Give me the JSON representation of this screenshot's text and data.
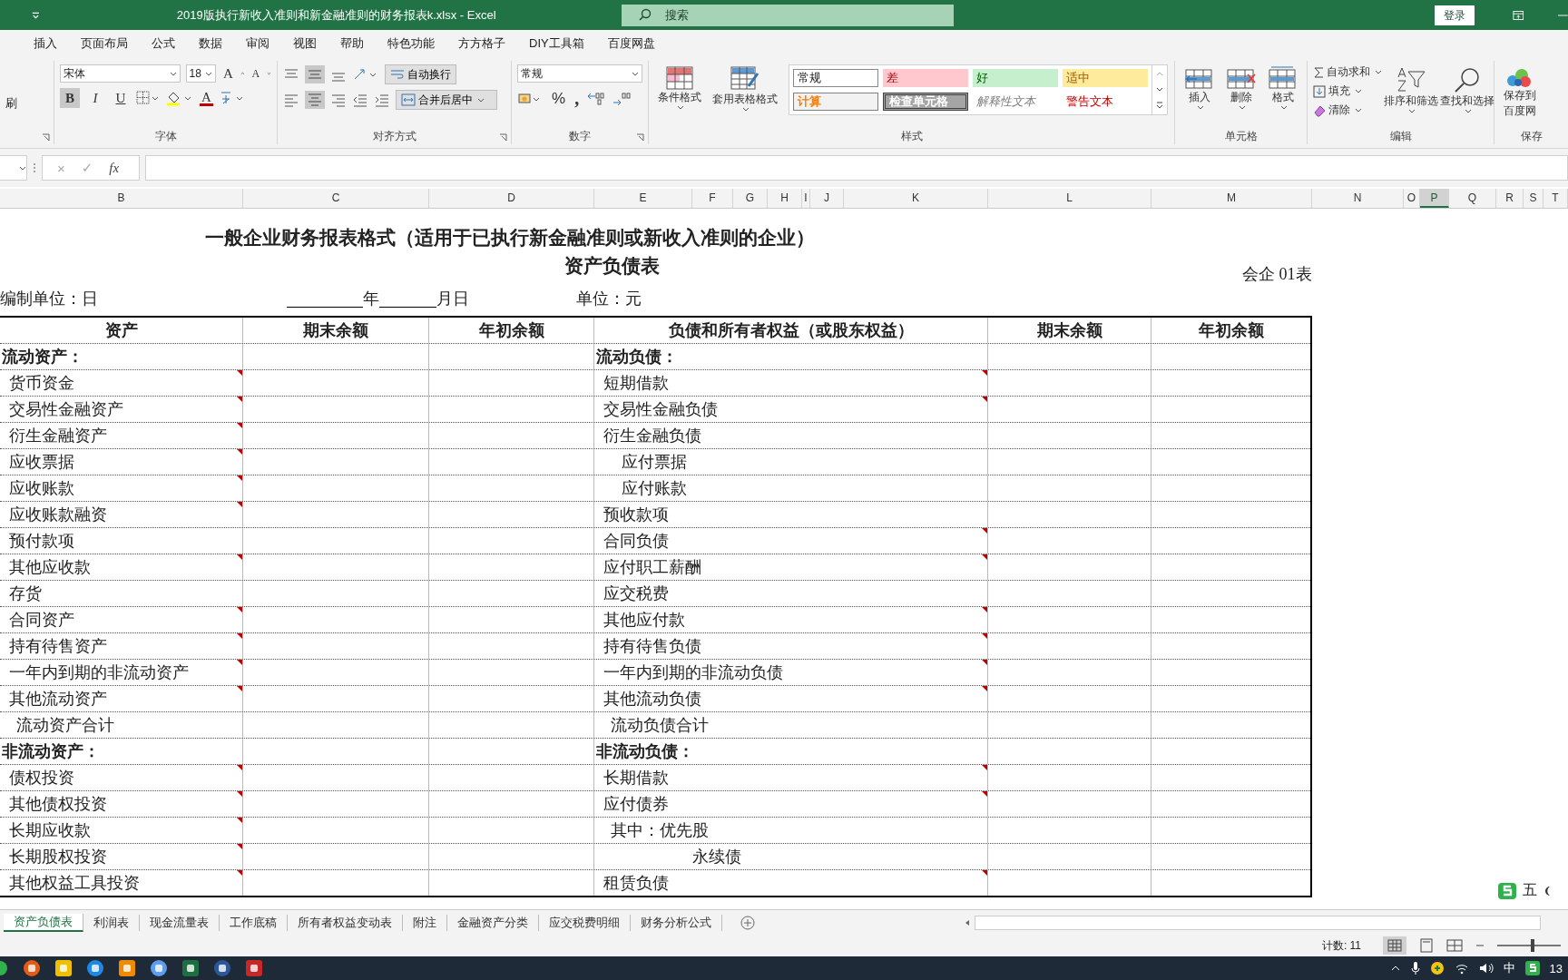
{
  "window": {
    "title": "2019版执行新收入准则和新金融准则的财务报表k.xlsx  -  Excel",
    "search_placeholder": "搜索",
    "login": "登录"
  },
  "ribbon_tabs": [
    "插入",
    "页面布局",
    "公式",
    "数据",
    "审阅",
    "视图",
    "帮助",
    "特色功能",
    "方方格子",
    "DIY工具箱",
    "百度网盘"
  ],
  "ribbon": {
    "clipboard_partial": "刷",
    "font": {
      "name": "宋体",
      "size": "18",
      "grow": "A",
      "shrink": "A",
      "style_buttons": [
        "B",
        "I",
        "U"
      ],
      "font_color": "A",
      "label": "字体"
    },
    "alignment": {
      "wrap": "自动换行",
      "merge": "合并后居中",
      "label": "对齐方式"
    },
    "number": {
      "format": "常规",
      "percent": "%",
      "comma": ",",
      "label": "数字"
    },
    "styles": {
      "conditional": "条件格式",
      "table": "套用表格格式",
      "label": "样式",
      "cells": [
        {
          "text": "常规",
          "kind": "normal"
        },
        {
          "text": "差",
          "kind": "bad"
        },
        {
          "text": "好",
          "kind": "good"
        },
        {
          "text": "适中",
          "kind": "neutral"
        },
        {
          "text": "计算",
          "kind": "calc"
        },
        {
          "text": "检查单元格",
          "kind": "check"
        },
        {
          "text": "解释性文本",
          "kind": "explain"
        },
        {
          "text": "警告文本",
          "kind": "warn"
        }
      ]
    },
    "cells": {
      "buttons": [
        "插入",
        "删除",
        "格式"
      ],
      "label": "单元格"
    },
    "editing": {
      "autosum": "自动求和",
      "fill": "填充",
      "clear": "清除",
      "sort": "排序和筛选",
      "find": "查找和选择",
      "label": "编辑"
    },
    "save": {
      "line1": "保存到",
      "line2": "百度网",
      "label": "保存"
    }
  },
  "formula_bar": {
    "cancel": "×",
    "enter": "✓",
    "fx": "fx"
  },
  "column_headers": [
    {
      "label": "B",
      "selected": false
    },
    {
      "label": "C",
      "selected": false
    },
    {
      "label": "D",
      "selected": false
    },
    {
      "label": "E",
      "selected": false
    },
    {
      "label": "F",
      "selected": false
    },
    {
      "label": "G",
      "selected": false
    },
    {
      "label": "H",
      "selected": false
    },
    {
      "label": "I",
      "selected": false
    },
    {
      "label": "J",
      "selected": false
    },
    {
      "label": "K",
      "selected": false
    },
    {
      "label": "L",
      "selected": false
    },
    {
      "label": "M",
      "selected": false
    },
    {
      "label": "N",
      "selected": false
    },
    {
      "label": "O",
      "selected": false
    },
    {
      "label": "P",
      "selected": true
    },
    {
      "label": "Q",
      "selected": false
    },
    {
      "label": "R",
      "selected": false
    },
    {
      "label": "S",
      "selected": false
    },
    {
      "label": "T",
      "selected": false
    }
  ],
  "sheet": {
    "title": "一般企业财务报表格式（适用于已执行新金融准则或新收入准则的企业）",
    "subtitle": "资产负债表",
    "form_no": "会企  01表",
    "org": "编制单位：日",
    "year": "年",
    "monthday": "月日",
    "currency": "单位：元",
    "columns": [
      "资产",
      "期末余额",
      "年初余额",
      "负债和所有者权益（或股东权益）",
      "期末余额",
      "年初余额"
    ],
    "rows": [
      {
        "left": {
          "text": "流动资产：",
          "kind": "section",
          "comment": false
        },
        "right": {
          "text": "流动负债：",
          "kind": "section",
          "comment": false
        }
      },
      {
        "left": {
          "text": "货币资金",
          "kind": "item",
          "comment": true
        },
        "right": {
          "text": "短期借款",
          "kind": "item",
          "comment": true
        }
      },
      {
        "left": {
          "text": "交易性金融资产",
          "kind": "item",
          "comment": true
        },
        "right": {
          "text": "交易性金融负债",
          "kind": "item",
          "comment": true
        }
      },
      {
        "left": {
          "text": "衍生金融资产",
          "kind": "item",
          "comment": true
        },
        "right": {
          "text": "衍生金融负债",
          "kind": "item",
          "comment": false
        }
      },
      {
        "left": {
          "text": "应收票据",
          "kind": "item",
          "comment": true
        },
        "right": {
          "text": "应付票据",
          "kind": "sub",
          "comment": false
        }
      },
      {
        "left": {
          "text": "应收账款",
          "kind": "item",
          "comment": true
        },
        "right": {
          "text": "应付账款",
          "kind": "sub",
          "comment": false
        }
      },
      {
        "left": {
          "text": "应收账款融资",
          "kind": "item",
          "comment": true
        },
        "right": {
          "text": "预收款项",
          "kind": "item",
          "comment": false
        }
      },
      {
        "left": {
          "text": "预付款项",
          "kind": "item",
          "comment": false
        },
        "right": {
          "text": "合同负债",
          "kind": "item",
          "comment": true
        }
      },
      {
        "left": {
          "text": "其他应收款",
          "kind": "item",
          "comment": true
        },
        "right": {
          "text": "应付职工薪酬",
          "kind": "item",
          "comment": true
        }
      },
      {
        "left": {
          "text": "存货",
          "kind": "item",
          "comment": false
        },
        "right": {
          "text": "应交税费",
          "kind": "item",
          "comment": false
        }
      },
      {
        "left": {
          "text": "合同资产",
          "kind": "item",
          "comment": true
        },
        "right": {
          "text": "其他应付款",
          "kind": "item",
          "comment": true
        }
      },
      {
        "left": {
          "text": "持有待售资产",
          "kind": "item",
          "comment": true
        },
        "right": {
          "text": "持有待售负债",
          "kind": "item",
          "comment": true
        }
      },
      {
        "left": {
          "text": "一年内到期的非流动资产",
          "kind": "item",
          "comment": true
        },
        "right": {
          "text": "一年内到期的非流动负债",
          "kind": "item",
          "comment": true
        }
      },
      {
        "left": {
          "text": "其他流动资产",
          "kind": "item",
          "comment": true
        },
        "right": {
          "text": "其他流动负债",
          "kind": "item",
          "comment": true
        }
      },
      {
        "left": {
          "text": "流动资产合计",
          "kind": "total",
          "comment": false
        },
        "right": {
          "text": "流动负债合计",
          "kind": "total",
          "comment": false
        }
      },
      {
        "left": {
          "text": "非流动资产：",
          "kind": "section",
          "comment": false
        },
        "right": {
          "text": "非流动负债：",
          "kind": "section",
          "comment": false
        }
      },
      {
        "left": {
          "text": "债权投资",
          "kind": "item",
          "comment": true
        },
        "right": {
          "text": "长期借款",
          "kind": "item",
          "comment": true
        }
      },
      {
        "left": {
          "text": "其他债权投资",
          "kind": "item",
          "comment": true
        },
        "right": {
          "text": "应付债券",
          "kind": "item",
          "comment": true
        }
      },
      {
        "left": {
          "text": "长期应收款",
          "kind": "item",
          "comment": true
        },
        "right": {
          "text": "其中：优先股",
          "kind": "total",
          "comment": false
        }
      },
      {
        "left": {
          "text": "长期股权投资",
          "kind": "item",
          "comment": true
        },
        "right": {
          "text": "永续债",
          "kind": "far",
          "comment": false
        }
      },
      {
        "left": {
          "text": "其他权益工具投资",
          "kind": "item",
          "comment": true
        },
        "right": {
          "text": "租赁负债",
          "kind": "item",
          "comment": true
        }
      }
    ]
  },
  "sheet_tabs": [
    {
      "label": "资产负债表",
      "selected": true
    },
    {
      "label": "利润表",
      "selected": false
    },
    {
      "label": "现金流量表",
      "selected": false
    },
    {
      "label": "工作底稿",
      "selected": false
    },
    {
      "label": "所有者权益变动表",
      "selected": false
    },
    {
      "label": "附注",
      "selected": false
    },
    {
      "label": "金融资产分类",
      "selected": false
    },
    {
      "label": "应交税费明细",
      "selected": false
    },
    {
      "label": "财务分析公式",
      "selected": false
    }
  ],
  "status_bar": {
    "count": "计数: 11",
    "zoom": {
      "level": 0.55
    }
  },
  "ime_toolbar": {
    "mode": "五"
  },
  "taskbar": {
    "ime": "中",
    "clock": "13"
  }
}
